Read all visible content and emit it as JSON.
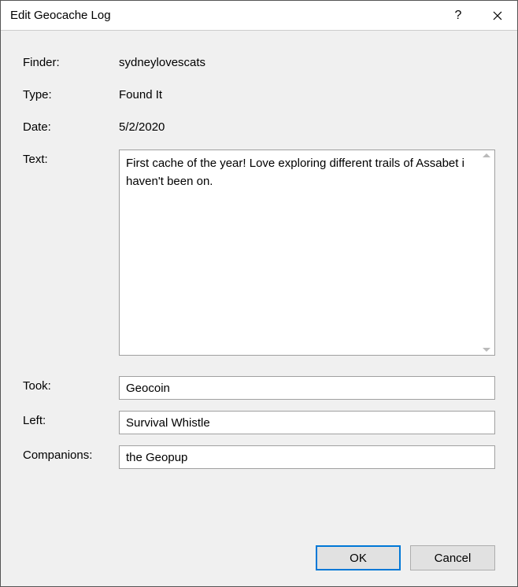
{
  "titlebar": {
    "title": "Edit Geocache Log"
  },
  "labels": {
    "finder": "Finder:",
    "type": "Type:",
    "date": "Date:",
    "text": "Text:",
    "took": "Took:",
    "left": "Left:",
    "companions": "Companions:"
  },
  "values": {
    "finder": "sydneylovescats",
    "type": "Found It",
    "date": "5/2/2020",
    "text": "First cache of the year! Love exploring different trails of Assabet i haven't been on.",
    "took": "Geocoin",
    "left": "Survival Whistle",
    "companions": "the Geopup"
  },
  "buttons": {
    "ok": "OK",
    "cancel": "Cancel"
  }
}
